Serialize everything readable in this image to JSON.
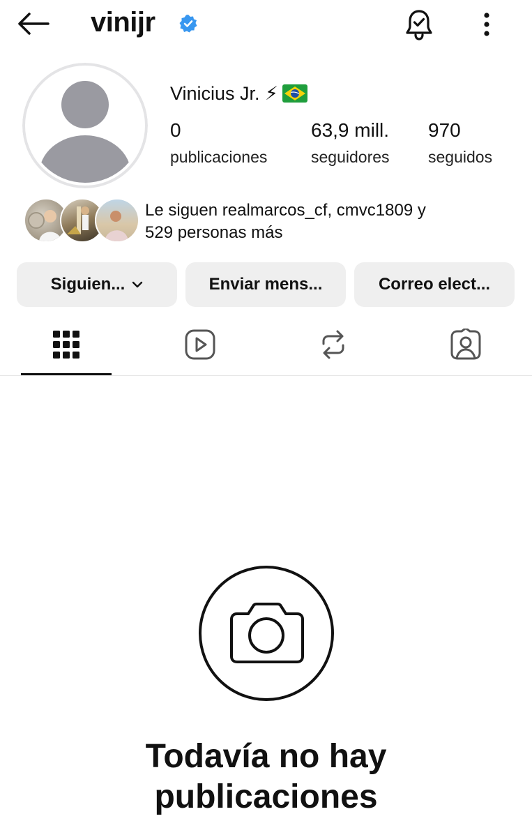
{
  "header": {
    "username": "vinijr",
    "verified_color": "#3897f0"
  },
  "profile": {
    "full_name": "Vinicius Jr. ⚡",
    "stats": [
      {
        "value": "0",
        "label": "publicaciones"
      },
      {
        "value": "63,9 mill.",
        "label": "seguidores"
      },
      {
        "value": "970",
        "label": "seguidos"
      }
    ]
  },
  "followed_by": {
    "text_line1": "Le siguen realmarcos_cf, cmvc1809 y",
    "text_line2": "529 personas más"
  },
  "actions": {
    "following_label": "Siguien...",
    "message_label": "Enviar mens...",
    "email_label": "Correo elect..."
  },
  "tabs": [
    {
      "icon": "grid-icon",
      "selected": true
    },
    {
      "icon": "reels-icon",
      "selected": false
    },
    {
      "icon": "reposts-icon",
      "selected": false
    },
    {
      "icon": "tagged-icon",
      "selected": false
    }
  ],
  "empty_state": {
    "icon": "camera-icon",
    "title_line1": "Todavía no hay",
    "title_line2": "publicaciones"
  }
}
